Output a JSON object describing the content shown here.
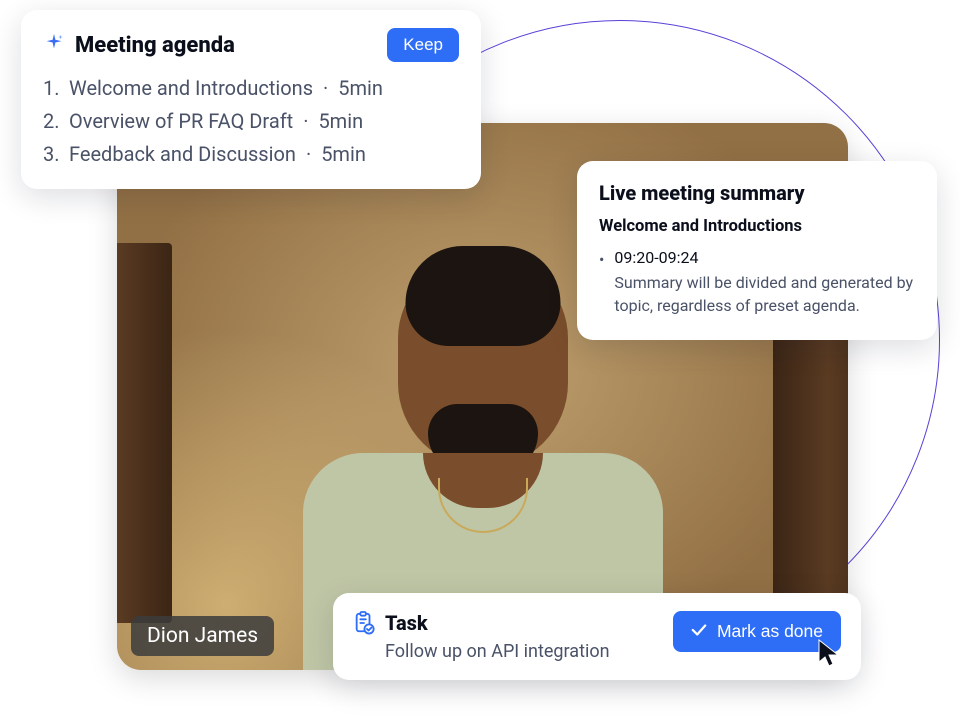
{
  "agenda": {
    "title": "Meeting agenda",
    "keep_label": "Keep",
    "items": [
      {
        "num": "1.",
        "label": "Welcome and Introductions",
        "duration": "5min"
      },
      {
        "num": "2.",
        "label": "Overview of PR FAQ Draft",
        "duration": "5min"
      },
      {
        "num": "3.",
        "label": "Feedback and Discussion",
        "duration": "5min"
      }
    ]
  },
  "video": {
    "participant_name": "Dion James"
  },
  "summary": {
    "title": "Live meeting summary",
    "section_heading": "Welcome and Introductions",
    "entry": {
      "time": "09:20-09:24",
      "text": "Summary will be divided and generated by topic, regardless of preset agenda."
    }
  },
  "task": {
    "label": "Task",
    "description": "Follow up on API integration",
    "mark_done_label": "Mark as done"
  },
  "colors": {
    "primary": "#2E6EF7",
    "accent_circle": "#5B3FD8"
  }
}
